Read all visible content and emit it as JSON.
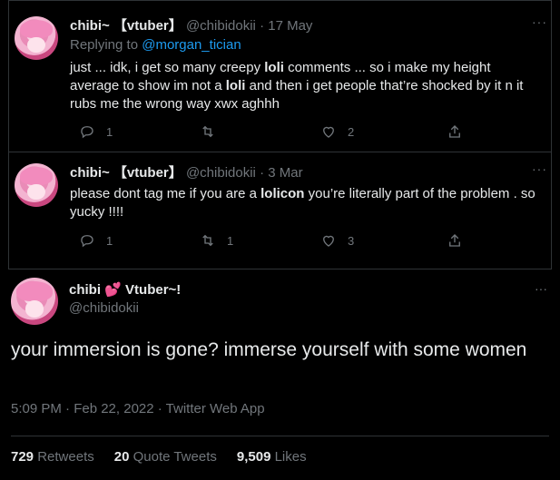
{
  "tweets": [
    {
      "name": "chibi~ 【vtuber】",
      "handle": "@chibidokii",
      "dot": "·",
      "date": "17 May",
      "replying_prefix": "Replying to ",
      "replying_to": "@morgan_tician",
      "text_parts": [
        "just ... idk, i get so many creepy ",
        "loli",
        " comments ... so i make my height average to show im not a ",
        "loli",
        " and then i get people that’re shocked by it n it rubs me the wrong way xwx aghhh"
      ],
      "more": "···",
      "reply_count": "1",
      "retweet_count": "",
      "like_count": "2"
    },
    {
      "name": "chibi~ 【vtuber】",
      "handle": "@chibidokii",
      "dot": "·",
      "date": "3 Mar",
      "text_parts": [
        "please dont tag me if you are a ",
        "lolicon",
        " you’re literally part of the problem . so yucky !!!!"
      ],
      "more": "···",
      "reply_count": "1",
      "retweet_count": "1",
      "like_count": "3"
    }
  ],
  "main": {
    "name_part1": "chibi",
    "emoji": "💕",
    "name_part2": " Vtuber~!",
    "handle": "@chibidokii",
    "more": "···",
    "text": "your immersion is gone? immerse yourself with some women",
    "meta": "5:09 PM · Feb 22, 2022 · Twitter Web App",
    "stats": [
      {
        "value": "729",
        "label": "Retweets"
      },
      {
        "value": "20",
        "label": "Quote Tweets"
      },
      {
        "value": "9,509",
        "label": "Likes"
      }
    ]
  },
  "icons": [
    "reply-icon",
    "retweet-icon",
    "like-icon",
    "share-icon",
    "more-icon"
  ],
  "colors": {
    "background": "#000000",
    "text": "#e7e9ea",
    "muted": "#71767b",
    "link": "#1d9bf0",
    "border": "#2f3336"
  }
}
